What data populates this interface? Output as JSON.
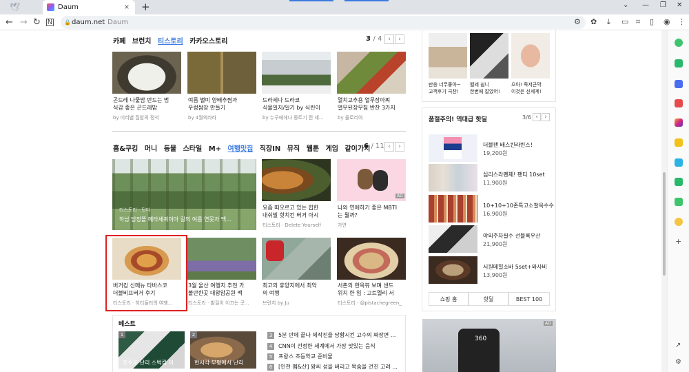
{
  "browser": {
    "tab_title": "Daum",
    "tab_close": "×",
    "new_tab": "+",
    "url": "daum.net",
    "url_title": "Daum"
  },
  "section1": {
    "tabs": [
      {
        "label": "카페",
        "active": false
      },
      {
        "label": "브런치",
        "active": false
      },
      {
        "label": "티스토리",
        "active": true
      },
      {
        "label": "카카오스토리",
        "active": false
      }
    ],
    "page_current": "3",
    "page_total": "/ 4",
    "cards": [
      {
        "caption1": "곤드레 나물밥 만드는 법",
        "caption2": "식감 좋은 곤드레밥",
        "source": "by 미리별 집밥의 정석"
      },
      {
        "caption1": "여름 별미 양배추찜과",
        "caption2": "우렁쌈장 만들기",
        "source": "by 4월의라라"
      },
      {
        "caption1": "드라세나 드라코",
        "caption2": "식물일지/일기 by 식린이",
        "source": "by 누구에게나 동트기 전 세..."
      },
      {
        "caption1": "멸치고추용 열무장아찌",
        "caption2": "열무된장무침 반찬 3가지",
        "source": "by 올로리아"
      }
    ]
  },
  "section2": {
    "tabs": [
      {
        "label": "홈&쿠킹",
        "active": false
      },
      {
        "label": "머니",
        "active": false
      },
      {
        "label": "동물",
        "active": false
      },
      {
        "label": "스타일",
        "active": false
      },
      {
        "label": "M+",
        "active": false
      },
      {
        "label": "여행맛집",
        "active": true
      },
      {
        "label": "직장IN",
        "active": false
      },
      {
        "label": "뮤직",
        "active": false
      },
      {
        "label": "웹툰",
        "active": false
      },
      {
        "label": "게임",
        "active": false
      },
      {
        "label": "같이가치",
        "active": false
      }
    ],
    "page_current": "6",
    "page_total": "/ 11",
    "big": {
      "overlay_src": "티스토리 · 닷다",
      "overlay_title": "하남 당정뜰 메타세쿼이아 길의 여름 연못과 맥..."
    },
    "cards": [
      {
        "caption1": "요즘 떠오르고 있는 힙한",
        "caption2": "내쉬빌 핫치킨 버거 아시",
        "source": "티스토리 · Delete Yourself"
      },
      {
        "caption1": "나와 연애하기 좋은 MBTI",
        "caption2": "는 뭘까?",
        "source": "가연",
        "badge": "AD"
      },
      {
        "caption1": "버거킹 신메뉴 타바스코",
        "caption2": "더블비프버거 후기",
        "source": "티스토리 · 히티들러의 여행..."
      },
      {
        "caption1": "3월 울산 여행지 추천 가",
        "caption2": "볼만한곳 대왕암공원 맥",
        "source": "티스토리 · 발걸이 이끄는 곳..."
      },
      {
        "caption1": "최고의 휴양지에서 최악",
        "caption2": "의 여행",
        "source": "브런치 by Ju"
      },
      {
        "caption1": "서촌의 한옥뷰 보며 샌드",
        "caption2": "위치 한 입 : 고트멜리 서",
        "source": "티스토리 · @pistachegreen_"
      }
    ]
  },
  "best": {
    "title": "베스트",
    "thumbs": [
      {
        "num": "1",
        "caption": "호주도 난리 스벅컵 이"
      },
      {
        "num": "2",
        "caption": "현시각 부평에서 난리"
      }
    ],
    "items": [
      {
        "num": "3",
        "text": "5분 만에 끝나 제작진을 당황시킨 고수의 짜장면 ..."
      },
      {
        "num": "4",
        "text": "CNN이 선정한 세계에서 가장 맛있는 음식"
      },
      {
        "num": "5",
        "text": "프랑스 초등학교 준비물"
      },
      {
        "num": "6",
        "text": "[인천 펨&산] 왕씨 성을 버리고 목숨을 건진 고려 ..."
      }
    ]
  },
  "right": {
    "top_products": [
      {
        "caption1": "반응 너무좋아~",
        "caption2": "고객후기 극찬!"
      },
      {
        "caption1": "벨레 쉽니",
        "caption2": "한번에 잡았어!"
      },
      {
        "caption1": "으아! 족저근막",
        "caption2": "이것은 신세계!"
      }
    ],
    "deal_title": "품절주의! 역대급 핫딜",
    "deal_page": "3/6",
    "deals": [
      {
        "name": "더블팬 배스킨라빈스!",
        "price": "19,200원"
      },
      {
        "name": "심리스라펜체! 팬티 10set",
        "price": "11,900원"
      },
      {
        "name": "10+10+10존특고소찰옥수수",
        "price": "16,900원"
      },
      {
        "name": "야외주차필수 선블록우산",
        "price": "21,900원"
      },
      {
        "name": "시원메밀소바 5set+와사비",
        "price": "13,900원"
      }
    ],
    "bottom_tabs": [
      "쇼핑 홈",
      "핫딜",
      "BEST 100"
    ],
    "ad_badge": "AD",
    "ad_screen": "360"
  }
}
